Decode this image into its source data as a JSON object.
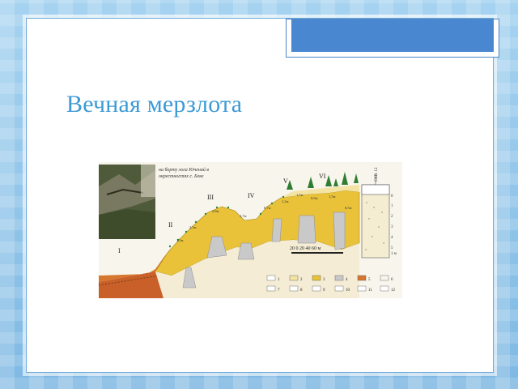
{
  "slide": {
    "title": "Вечная мерзлота"
  },
  "figure": {
    "caption_line1": "на борту лога Юченай в",
    "caption_line2": "окрестностях с. Беке",
    "roman_labels": [
      "I",
      "II",
      "III",
      "IV",
      "V",
      "VI"
    ],
    "scale_text": "20  0  20  40  60 м",
    "depth_labels": [
      "1,5м",
      "2,3м",
      "2,8м",
      "2,7м",
      "0,7м",
      "1,2м",
      "1,5м",
      "0,9м",
      "1,5м",
      "0,5м"
    ],
    "legend_numbers": [
      "1",
      "2",
      "3",
      "4",
      "5",
      "6",
      "7",
      "8",
      "9",
      "10",
      "11",
      "12"
    ],
    "column_numbers": [
      "0",
      "1",
      "2",
      "3",
      "4",
      "5"
    ],
    "column_depth": "1 м",
    "column_top": "СКВ. 12",
    "colors": {
      "permafrost_yellow": "#e9c23a",
      "bedrock_orange": "#d7772e",
      "photo_dark": "#4f5a3a",
      "ice_gray": "#c9c9c9"
    }
  }
}
